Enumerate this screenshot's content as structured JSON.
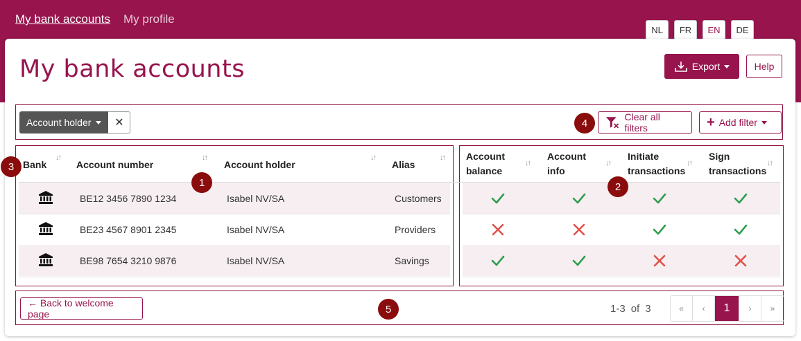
{
  "nav": {
    "items": [
      {
        "label": "My bank accounts",
        "active": true
      },
      {
        "label": "My profile",
        "active": false
      }
    ]
  },
  "languages": [
    {
      "code": "NL",
      "selected": false
    },
    {
      "code": "FR",
      "selected": false
    },
    {
      "code": "EN",
      "selected": true
    },
    {
      "code": "DE",
      "selected": false
    }
  ],
  "page": {
    "title": "My bank accounts"
  },
  "toolbar": {
    "export_label": "Export",
    "help_label": "Help"
  },
  "filters": {
    "active_filter": "Account holder",
    "clear_all_label": "Clear all filters",
    "add_filter_label": "Add filter"
  },
  "badges": [
    "1",
    "2",
    "3",
    "4",
    "5"
  ],
  "table": {
    "columns": {
      "bank": "Bank",
      "account_number": "Account number",
      "account_holder": "Account holder",
      "alias": "Alias",
      "account_balance_1": "Account",
      "account_balance_2": "balance",
      "account_info_1": "Account",
      "account_info_2": "info",
      "initiate_1": "Initiate",
      "initiate_2": "transactions",
      "sign_1": "Sign",
      "sign_2": "transactions"
    },
    "rows": [
      {
        "bank_icon": "bank-icon",
        "account_number": "BE12 3456 7890 1234",
        "account_holder": "Isabel NV/SA",
        "alias": "Customers",
        "account_balance": true,
        "account_info": true,
        "initiate": true,
        "sign": true
      },
      {
        "bank_icon": "bank-icon",
        "account_number": "BE23 4567 8901 2345",
        "account_holder": "Isabel NV/SA",
        "alias": "Providers",
        "account_balance": false,
        "account_info": false,
        "initiate": true,
        "sign": true
      },
      {
        "bank_icon": "bank-icon",
        "account_number": "BE98 7654 3210 9876",
        "account_holder": "Isabel NV/SA",
        "alias": "Savings",
        "account_balance": true,
        "account_info": true,
        "initiate": false,
        "sign": false
      }
    ]
  },
  "footer": {
    "back_label": "← Back to welcome page",
    "range": "1-3",
    "of_label": "of",
    "total": "3"
  },
  "pagination": {
    "first": "«",
    "prev": "‹",
    "current": "1",
    "next": "›",
    "last": "»"
  },
  "colors": {
    "brand": "#97144d",
    "check": "#2e9e4f",
    "cross": "#e0524a",
    "badge": "#8a0c0c"
  }
}
